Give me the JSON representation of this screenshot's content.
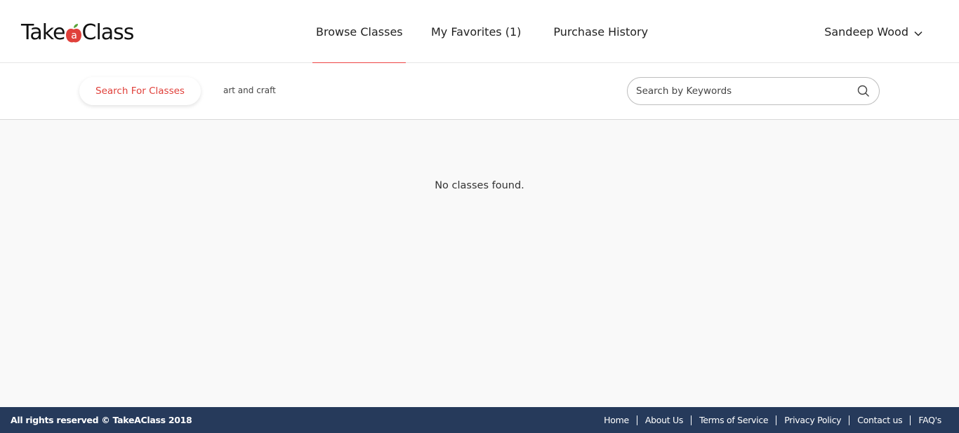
{
  "brand": {
    "name_prefix": "Take",
    "name_suffix": "Class",
    "apple_letter": "a",
    "accent_color": "#e0403a",
    "leaf_color": "#5aa43a"
  },
  "nav": {
    "items": [
      {
        "label": "Browse Classes",
        "active": true
      },
      {
        "label": "My Favorites (1)",
        "active": false
      },
      {
        "label": "Purchase History",
        "active": false
      }
    ]
  },
  "user": {
    "name": "Sandeep Wood",
    "menu_icon": "chevron-down-icon"
  },
  "subbar": {
    "search_for_classes_label": "Search For Classes",
    "active_filter": "art and craft",
    "search_placeholder": "Search by Keywords",
    "search_value": "",
    "search_icon": "search-icon"
  },
  "main": {
    "empty_message": "No classes found."
  },
  "footer": {
    "copyright": "All rights reserved © TakeAClass 2018",
    "links": [
      "Home",
      "About Us",
      "Terms of Service",
      "Privacy Policy",
      "Contact us",
      "FAQ's"
    ],
    "background": "#263a5b"
  }
}
